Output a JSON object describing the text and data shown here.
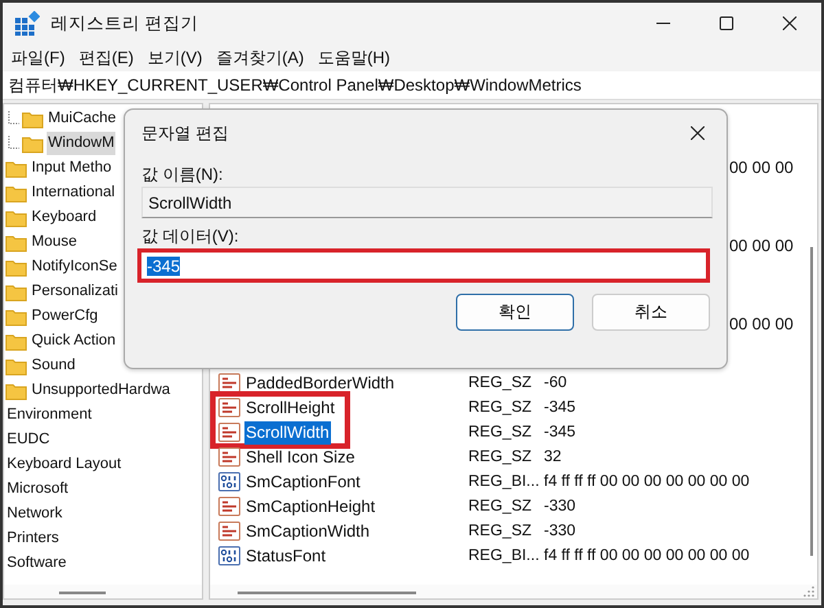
{
  "window": {
    "title": "레지스트리 편집기"
  },
  "menu": [
    "파일(F)",
    "편집(E)",
    "보기(V)",
    "즐겨찾기(A)",
    "도움말(H)"
  ],
  "address": "컴퓨터₩HKEY_CURRENT_USER₩Control Panel₩Desktop₩WindowMetrics",
  "tree": {
    "groups": [
      {
        "kind": "nested",
        "items": [
          {
            "label": "MuiCache",
            "selected": false
          },
          {
            "label": "WindowM",
            "selected": true
          }
        ]
      },
      {
        "kind": "folder",
        "items": [
          {
            "label": "Input Metho",
            "selected": false
          },
          {
            "label": "International",
            "selected": false
          },
          {
            "label": "Keyboard",
            "selected": false
          },
          {
            "label": "Mouse",
            "selected": false
          },
          {
            "label": "NotifyIconSe",
            "selected": false
          },
          {
            "label": "Personalizati",
            "selected": false
          },
          {
            "label": "PowerCfg",
            "selected": false
          },
          {
            "label": "Quick Action",
            "selected": false
          },
          {
            "label": "Sound",
            "selected": false
          },
          {
            "label": "UnsupportedHardwa",
            "selected": false
          }
        ]
      },
      {
        "kind": "plain",
        "items": [
          {
            "label": "Environment",
            "selected": false
          },
          {
            "label": "EUDC",
            "selected": false
          },
          {
            "label": "Keyboard Layout",
            "selected": false
          },
          {
            "label": "Microsoft",
            "selected": false
          },
          {
            "label": "Network",
            "selected": false
          },
          {
            "label": "Printers",
            "selected": false
          },
          {
            "label": "Software",
            "selected": false
          }
        ]
      }
    ]
  },
  "covered_rows": [
    {
      "data": "00 00 00"
    },
    {
      "data": "00 00 00"
    },
    {
      "data": "00 00 00"
    }
  ],
  "values": [
    {
      "kind": "string",
      "name": "PaddedBorderWidth",
      "type": "REG_SZ",
      "data": "-60",
      "selected": false,
      "highlighted": false
    },
    {
      "kind": "string",
      "name": "ScrollHeight",
      "type": "REG_SZ",
      "data": "-345",
      "selected": false,
      "highlighted": true
    },
    {
      "kind": "string",
      "name": "ScrollWidth",
      "type": "REG_SZ",
      "data": "-345",
      "selected": true,
      "highlighted": true
    },
    {
      "kind": "string",
      "name": "Shell Icon Size",
      "type": "REG_SZ",
      "data": "32",
      "selected": false,
      "highlighted": false
    },
    {
      "kind": "binary",
      "name": "SmCaptionFont",
      "type": "REG_BI...",
      "data": "f4 ff ff ff 00 00 00 00 00 00 00",
      "selected": false,
      "highlighted": false
    },
    {
      "kind": "string",
      "name": "SmCaptionHeight",
      "type": "REG_SZ",
      "data": "-330",
      "selected": false,
      "highlighted": false
    },
    {
      "kind": "string",
      "name": "SmCaptionWidth",
      "type": "REG_SZ",
      "data": "-330",
      "selected": false,
      "highlighted": false
    },
    {
      "kind": "binary",
      "name": "StatusFont",
      "type": "REG_BI...",
      "data": "f4 ff ff ff 00 00 00 00 00 00 00",
      "selected": false,
      "highlighted": false
    }
  ],
  "dialog": {
    "title": "문자열 편집",
    "name_label": "값 이름(N):",
    "name_value": "ScrollWidth",
    "data_label": "값 데이터(V):",
    "data_value": "-345",
    "data_selected": true,
    "data_highlighted": true,
    "buttons": [
      {
        "label": "확인",
        "default": true
      },
      {
        "label": "취소",
        "default": false
      }
    ]
  }
}
